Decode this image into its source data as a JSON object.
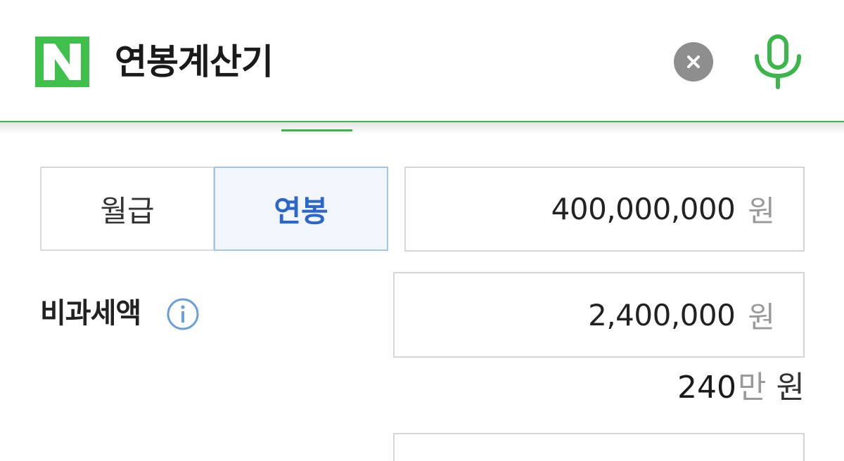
{
  "search": {
    "query": "연봉계산기"
  },
  "colors": {
    "brand_green": "#03C75A",
    "accent_blue": "#2B66C8"
  },
  "icons": {
    "logo": "naver-n-logo",
    "clear": "clear-icon",
    "mic": "microphone-icon",
    "info": "info-icon"
  },
  "calculator": {
    "salary_type": {
      "options": [
        "월급",
        "연봉"
      ],
      "selected": "연봉"
    },
    "salary": {
      "value": "400,000,000",
      "unit": "원"
    },
    "nontaxable": {
      "label": "비과세액",
      "value": "2,400,000",
      "unit": "원",
      "hint_number": "240",
      "hint_man": "만",
      "hint_won": "원"
    }
  }
}
